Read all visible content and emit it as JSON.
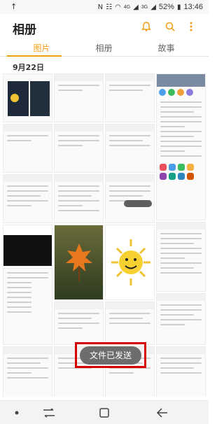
{
  "status_bar": {
    "left_icon": "upload-arrow-icon",
    "icons": [
      "nfc-icon",
      "vibrate-icon",
      "wifi-icon",
      "signal-icon"
    ],
    "network_4g": "4G",
    "network_3g": "3G",
    "battery": "52%",
    "time": "13:46"
  },
  "app_bar": {
    "title": "相册",
    "icons": [
      "bell-icon",
      "search-icon",
      "more-vert-icon"
    ]
  },
  "tabs": [
    {
      "label": "图片",
      "active": true
    },
    {
      "label": "相册",
      "active": false
    },
    {
      "label": "故事",
      "active": false
    }
  ],
  "date_header": "9月22日",
  "toast": {
    "text": "文件已发送"
  },
  "nav_bar": {
    "buttons": [
      "dot-button",
      "recent-apps-button",
      "home-button",
      "back-button"
    ]
  },
  "colors": {
    "accent": "#f39c12",
    "toast_bg": "#6d6d6d",
    "highlight": "#d60000"
  }
}
